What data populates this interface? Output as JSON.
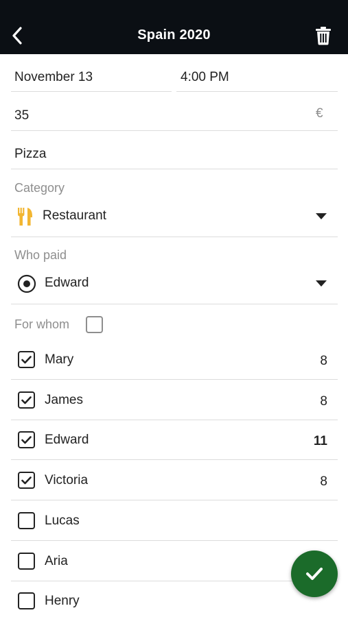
{
  "header": {
    "title": "Spain 2020"
  },
  "form": {
    "date": "November 13",
    "time": "4:00 PM",
    "amount": "35",
    "currency_symbol": "€",
    "description": "Pizza",
    "category_label": "Category",
    "category_value": "Restaurant",
    "who_paid_label": "Who paid",
    "who_paid_value": "Edward",
    "for_whom_label": "For whom"
  },
  "participants": [
    {
      "name": "Mary",
      "checked": true,
      "amount": "8",
      "bold": false
    },
    {
      "name": "James",
      "checked": true,
      "amount": "8",
      "bold": false
    },
    {
      "name": "Edward",
      "checked": true,
      "amount": "11",
      "bold": true
    },
    {
      "name": "Victoria",
      "checked": true,
      "amount": "8",
      "bold": false
    },
    {
      "name": "Lucas",
      "checked": false,
      "amount": "",
      "bold": false
    },
    {
      "name": "Aria",
      "checked": false,
      "amount": "",
      "bold": false
    },
    {
      "name": "Henry",
      "checked": false,
      "amount": "",
      "bold": false
    }
  ],
  "colors": {
    "header_bg": "#0b0f14",
    "accent": "#1b6b2a",
    "category_icon": "#f2b632"
  }
}
